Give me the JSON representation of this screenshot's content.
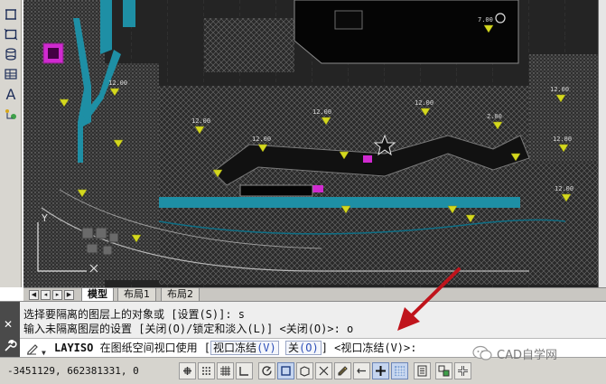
{
  "left_toolbar": {
    "items": [
      {
        "icon": "dimension-icon"
      },
      {
        "icon": "rectangle-icon"
      },
      {
        "icon": "cylinder-icon"
      },
      {
        "icon": "table-icon"
      },
      {
        "icon": "text-icon",
        "glyph": "A"
      },
      {
        "icon": "ucs-icon"
      }
    ]
  },
  "drawing": {
    "elevation_tags": [
      "12.00",
      "12.00",
      "12.00",
      "12.00",
      "12.00",
      "12.00",
      "12.00",
      "12.00",
      "7.00",
      "2.00"
    ],
    "ucs_label": "Y"
  },
  "tabs": {
    "items": [
      {
        "label": "模型",
        "active": true
      },
      {
        "label": "布局1",
        "active": false
      },
      {
        "label": "布局2",
        "active": false
      }
    ]
  },
  "command": {
    "history": [
      "选择要隔离的图层上的对象或 [设置(S)]: s",
      "输入未隔离图层的设置 [关闭(O)/锁定和淡入(L)] <关闭(O)>: o"
    ],
    "name": "LAYISO",
    "prompt_text": " 在图纸空间视口使用 [",
    "option1_text": "视口冻结",
    "option1_key": "(V)",
    "option2_text": "关",
    "option2_key": "(O)",
    "prompt_tail": "] <视口冻结(V)>:"
  },
  "status": {
    "coords": "-3451129, 662381331, 0",
    "buttons": [
      {
        "icon": "infer-constraints-icon",
        "on": false
      },
      {
        "icon": "snap-mode-icon",
        "on": false
      },
      {
        "icon": "grid-display-icon",
        "on": false
      },
      {
        "icon": "ortho-mode-icon",
        "on": false
      },
      {
        "icon": "polar-tracking-icon",
        "on": false
      },
      {
        "icon": "object-snap-icon",
        "on": true
      },
      {
        "icon": "3d-object-snap-icon",
        "on": false
      },
      {
        "icon": "object-snap-tracking-icon",
        "on": false
      },
      {
        "icon": "dynamic-ucs-icon",
        "on": false
      },
      {
        "icon": "dynamic-input-icon",
        "on": false
      },
      {
        "icon": "lineweight-icon",
        "on": true
      },
      {
        "icon": "transparency-icon",
        "on": true
      },
      {
        "icon": "quick-properties-icon",
        "on": false
      },
      {
        "icon": "selection-cycling-icon",
        "on": false
      },
      {
        "icon": "annotation-monitor-icon",
        "on": false
      }
    ]
  },
  "watermark": {
    "text": "CAD自学网"
  },
  "colors": {
    "canvas_bg": "#222222",
    "corridor": "#1e8fa5",
    "tag_yellow": "#d4d81e",
    "accent_magenta": "#d02ad0",
    "annotation_red": "#c0141c"
  }
}
